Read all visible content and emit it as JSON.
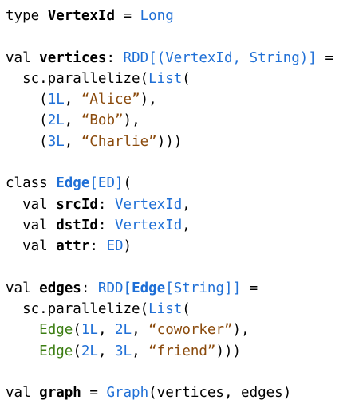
{
  "colors": {
    "type": "#1f6fd6",
    "string": "#8a4a0c",
    "literal": "#1f6fd6",
    "constructor": "#3b7d12",
    "plain": "#000000"
  },
  "code": {
    "line1": {
      "kw": "type ",
      "name": "VertexId",
      "eq": " = ",
      "type": "Long"
    },
    "line3": {
      "kw": "val ",
      "name": "vertices",
      "colon": ": ",
      "type": "RDD[(VertexId, String)]",
      "eq": " ="
    },
    "line4": {
      "indent": "  ",
      "call": "sc.parallelize(",
      "type": "List",
      "open": "("
    },
    "line5": {
      "indent": "    ",
      "open": "(",
      "lit": "1L",
      "comma": ", ",
      "str": "“Alice”",
      "close": "),"
    },
    "line6": {
      "indent": "    ",
      "open": "(",
      "lit": "2L",
      "comma": ", ",
      "str": "“Bob”",
      "close": "),"
    },
    "line7": {
      "indent": "    ",
      "open": "(",
      "lit": "3L",
      "comma": ", ",
      "str": "“Charlie”",
      "close": ")))"
    },
    "line9": {
      "kw": "class ",
      "name": "Edge",
      "type": "[ED]",
      "open": "("
    },
    "line10": {
      "indent": "  ",
      "kw": "val ",
      "name": "srcId",
      "colon": ": ",
      "type": "VertexId",
      "end": ","
    },
    "line11": {
      "indent": "  ",
      "kw": "val ",
      "name": "dstId",
      "colon": ": ",
      "type": "VertexId",
      "end": ","
    },
    "line12": {
      "indent": "  ",
      "kw": "val ",
      "name": "attr",
      "colon": ": ",
      "type": "ED",
      "end": ")"
    },
    "line14": {
      "kw": "val ",
      "name": "edges",
      "colon": ": ",
      "type_a": "RDD[",
      "type_b": "Edge",
      "type_c": "[String]]",
      "eq": " ="
    },
    "line15": {
      "indent": "  ",
      "call": "sc.parallelize(",
      "type": "List",
      "open": "("
    },
    "line16": {
      "indent": "    ",
      "ctor": "Edge",
      "open": "(",
      "lit1": "1L",
      "comma1": ", ",
      "lit2": "2L",
      "comma2": ", ",
      "str": "“coworker”",
      "close": "),"
    },
    "line17": {
      "indent": "    ",
      "ctor": "Edge",
      "open": "(",
      "lit1": "2L",
      "comma1": ", ",
      "lit2": "3L",
      "comma2": ", ",
      "str": "“friend”",
      "close": ")))"
    },
    "line19": {
      "kw": "val ",
      "name": "graph",
      "eq": " = ",
      "type": "Graph",
      "args": "(vertices, edges)"
    }
  }
}
